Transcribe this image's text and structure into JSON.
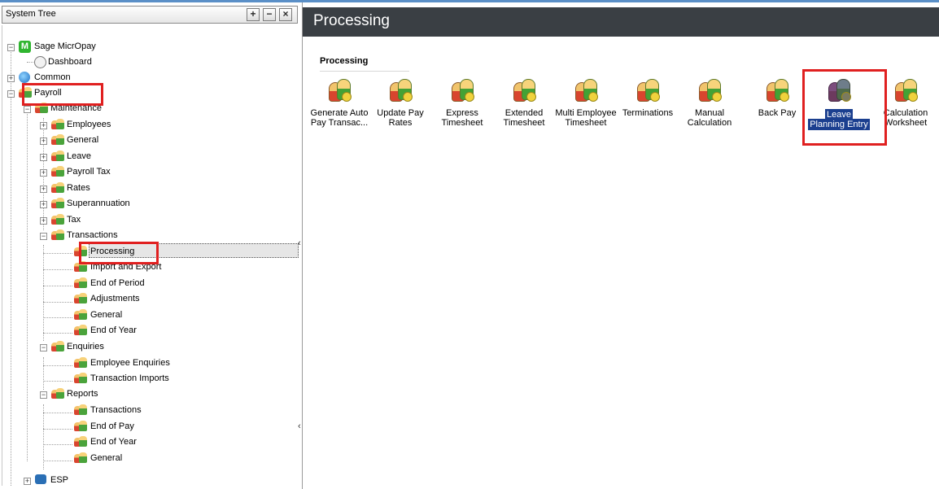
{
  "system_tree": {
    "title": "System Tree",
    "expand_all": "+",
    "collapse_all": "−",
    "close": "×",
    "root": "Sage MicrOpay",
    "items": {
      "dashboard": "Dashboard",
      "common": "Common",
      "payroll": "Payroll",
      "maintenance": "Maintenance",
      "employees": "Employees",
      "general": "General",
      "leave": "Leave",
      "payroll_tax": "Payroll Tax",
      "rates": "Rates",
      "superannuation": "Superannuation",
      "tax": "Tax",
      "transactions": "Transactions",
      "processing": "Processing",
      "import_export": "Import and Export",
      "end_of_period": "End of Period",
      "adjustments": "Adjustments",
      "general2": "General",
      "end_of_year": "End of Year",
      "enquiries": "Enquiries",
      "employee_enquiries": "Employee Enquiries",
      "transaction_imports": "Transaction Imports",
      "reports": "Reports",
      "rep_transactions": "Transactions",
      "rep_end_of_pay": "End of Pay",
      "rep_end_of_year": "End of Year",
      "rep_general": "General",
      "esp": "ESP"
    }
  },
  "main": {
    "banner_title": "Processing",
    "group_title": "Processing",
    "tiles": [
      {
        "line1": "Generate Auto",
        "line2": "Pay Transac..."
      },
      {
        "line1": "Update Pay",
        "line2": "Rates"
      },
      {
        "line1": "Express",
        "line2": "Timesheet"
      },
      {
        "line1": "Extended",
        "line2": "Timesheet"
      },
      {
        "line1": "Multi Employee",
        "line2": "Timesheet"
      },
      {
        "line1": "Terminations",
        "line2": ""
      },
      {
        "line1": "Manual",
        "line2": "Calculation"
      },
      {
        "line1": "Back Pay",
        "line2": ""
      },
      {
        "line1": "Leave",
        "line2": "Planning Entry"
      },
      {
        "line1": "Calculation",
        "line2": "Worksheet"
      }
    ]
  },
  "colors": {
    "banner_bg": "#3a3f44",
    "highlight_box": "#e02020",
    "selected_tile_bg": "#1b3f8f"
  }
}
